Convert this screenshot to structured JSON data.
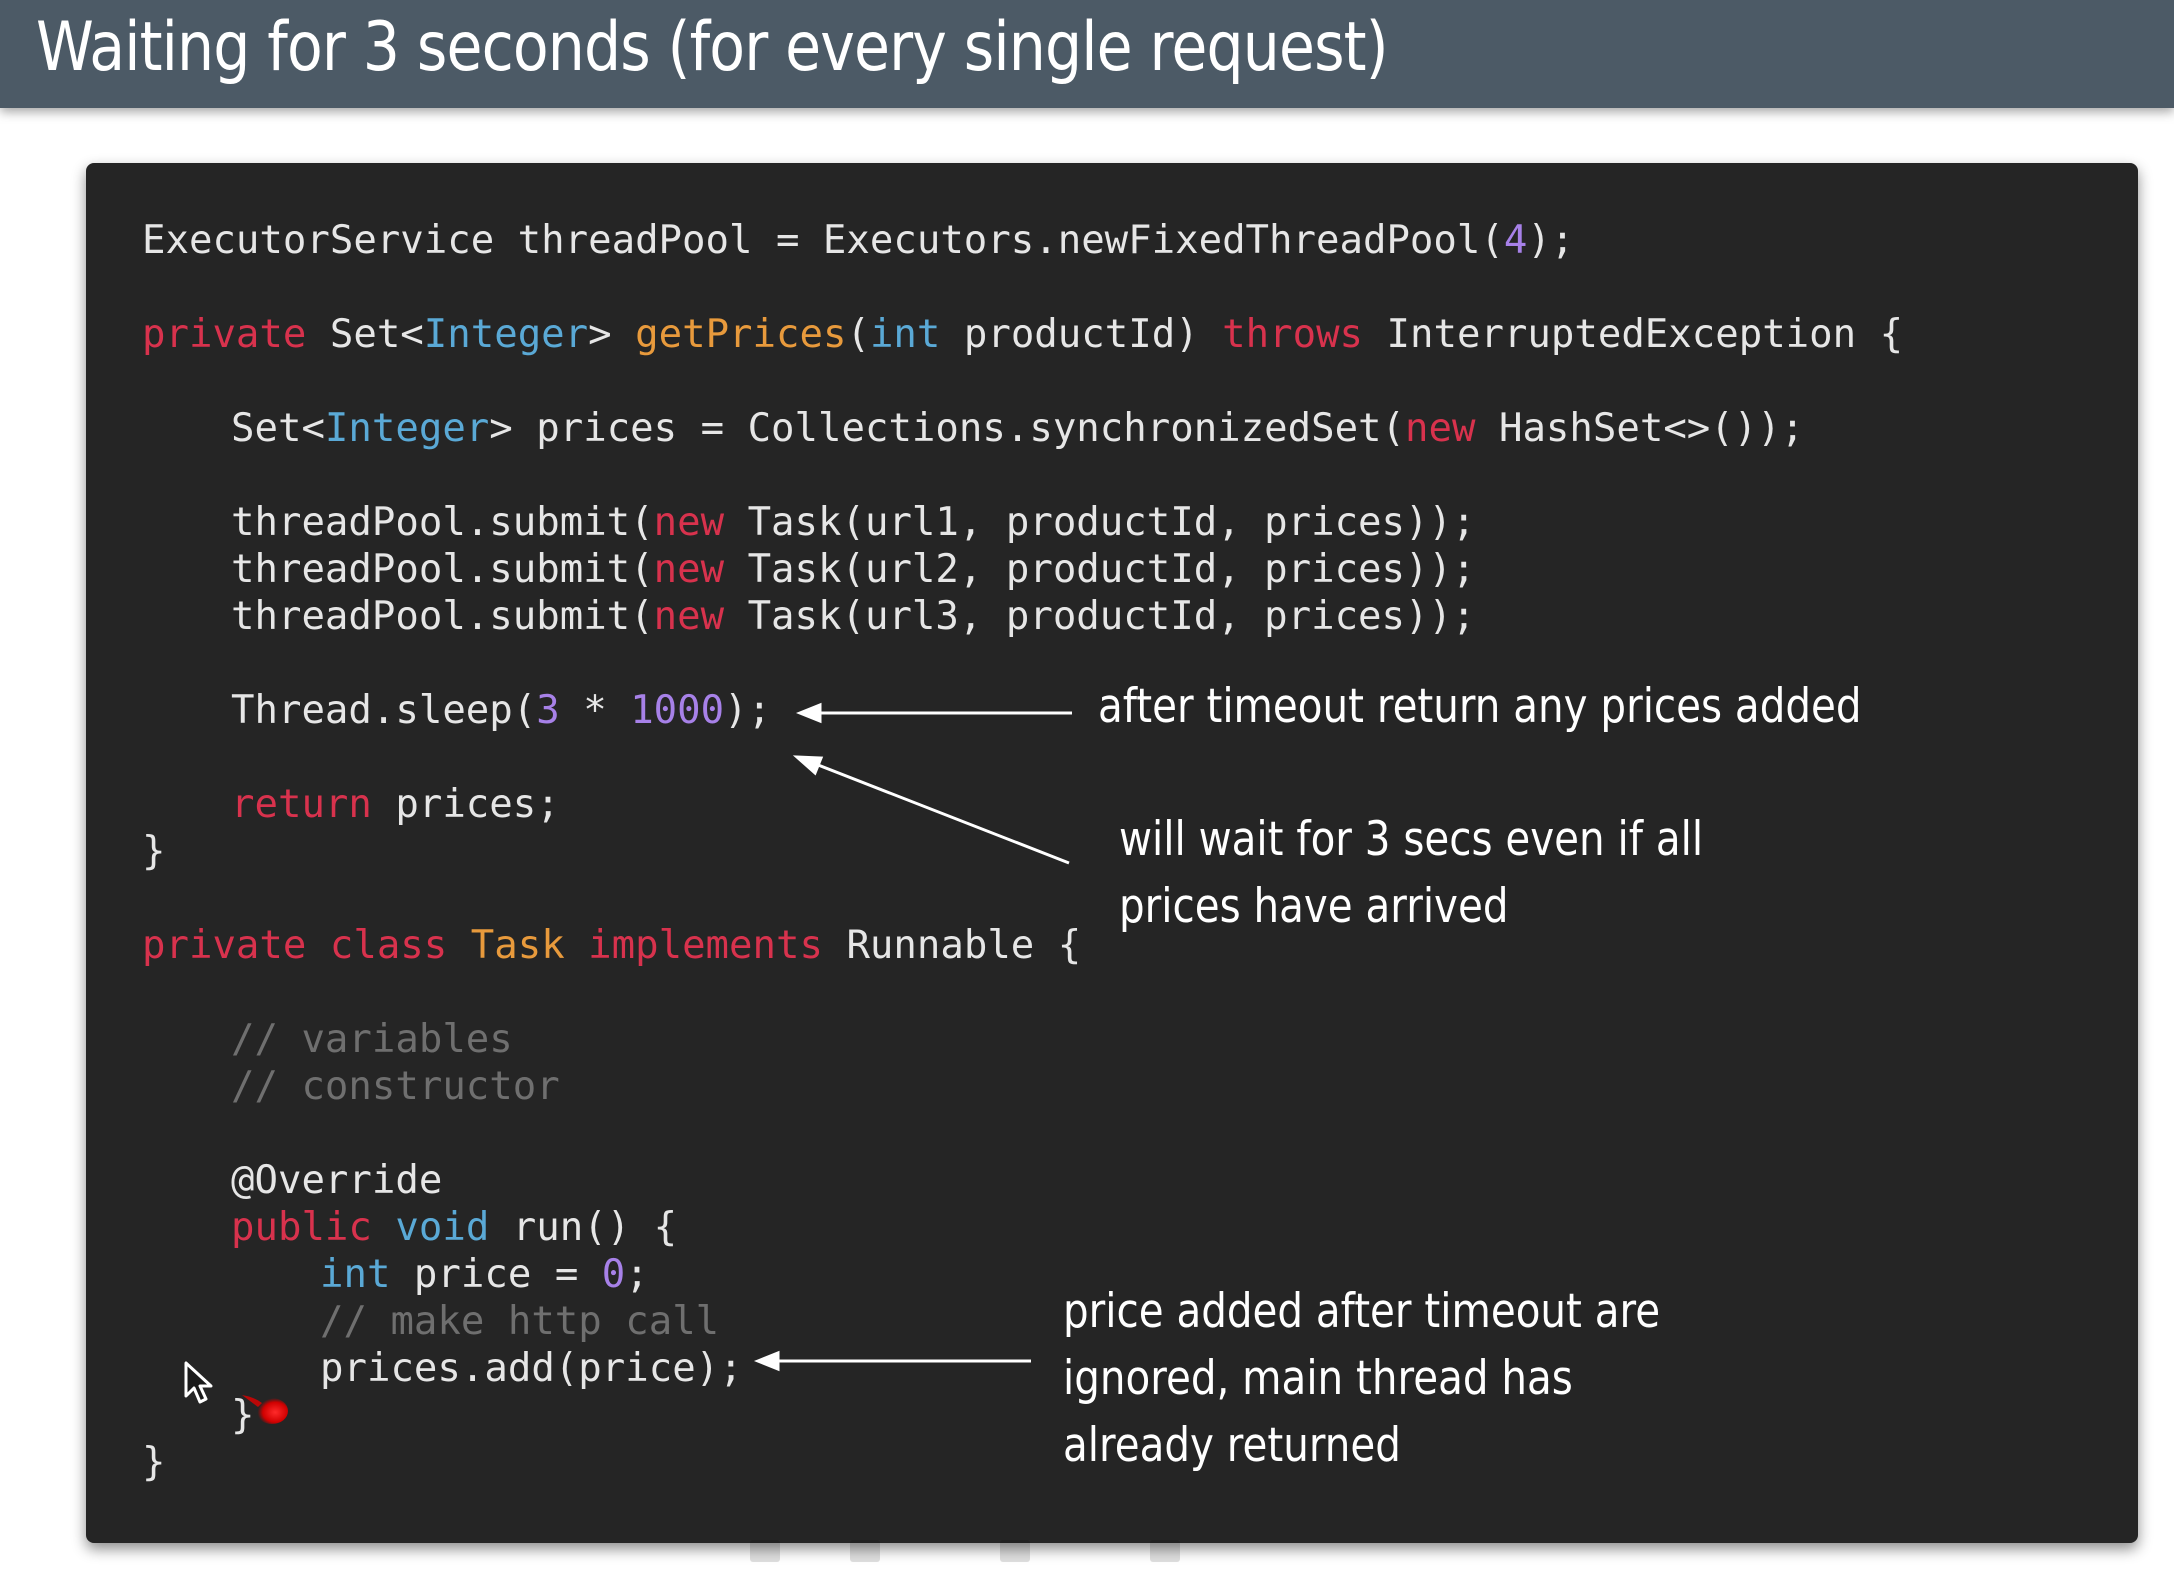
{
  "title": "Waiting for 3 seconds (for every single request)",
  "colors": {
    "title_bar": "#4c5a66",
    "code_background": "#252525",
    "keyword": "#d8324d",
    "type": "#5aa9d6",
    "method": "#e89a3c",
    "number": "#a781e8",
    "comment": "#6f6f6f",
    "plain": "#e6e6e6"
  },
  "code": {
    "line1": {
      "a": "ExecutorService threadPool = Executors.newFixedThreadPool(",
      "b": "4",
      "c": ");"
    },
    "line2": {
      "a": "private",
      "b": " Set<",
      "c": "Integer",
      "d": "> ",
      "e": "getPrices",
      "f": "(",
      "g": "int",
      "h": " productId) ",
      "i": "throws",
      "j": " InterruptedException {"
    },
    "line3": {
      "a": "Set<",
      "b": "Integer",
      "c": "> prices = Collections.synchronizedSet(",
      "d": "new",
      "e": " HashSet<>());"
    },
    "submits": [
      {
        "a": "threadPool.submit(",
        "b": "new",
        "c": " Task(url1, productId, prices));"
      },
      {
        "a": "threadPool.submit(",
        "b": "new",
        "c": " Task(url2, productId, prices));"
      },
      {
        "a": "threadPool.submit(",
        "b": "new",
        "c": " Task(url3, productId, prices));"
      }
    ],
    "sleep": {
      "a": "Thread.sleep(",
      "b": "3",
      "c": " * ",
      "d": "1000",
      "e": ");"
    },
    "return_line": {
      "a": "return",
      "b": " prices;"
    },
    "close_brace": "}",
    "class_line": {
      "a": "private",
      "b": " ",
      "c": "class",
      "d": " ",
      "e": "Task",
      "f": " ",
      "g": "implements",
      "h": " Runnable {"
    },
    "comment_variables": "// variables",
    "comment_constructor": "// constructor",
    "override": "@Override",
    "run_line": {
      "a": "public",
      "b": " ",
      "c": "void",
      "d": " run() {"
    },
    "price_line": {
      "a": "int",
      "b": " price = ",
      "c": "0",
      "d": ";"
    },
    "comment_http": "// make http call",
    "add_line": "prices.add(price);",
    "inner_close": "}",
    "outer_close": "}"
  },
  "annotations": {
    "timeout": "after timeout return any prices added",
    "wait_line1": "will wait for 3 secs even if all",
    "wait_line2": "prices have arrived",
    "ignored_line1": "price added after timeout are",
    "ignored_line2": "ignored, main thread has",
    "ignored_line3": "already returned"
  },
  "icons": {
    "cursor": "mouse-pointer-icon",
    "laser": "laser-pointer-icon"
  }
}
